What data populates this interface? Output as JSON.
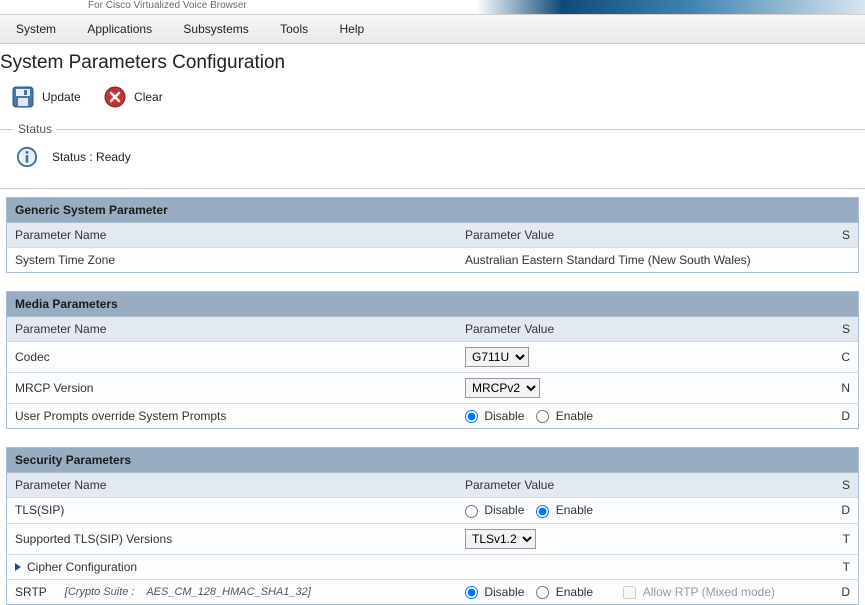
{
  "banner_subtitle": "For Cisco Virtualized Voice Browser",
  "menus": [
    "System",
    "Applications",
    "Subsystems",
    "Tools",
    "Help"
  ],
  "page_title": "System Parameters Configuration",
  "toolbar": {
    "update": "Update",
    "clear": "Clear"
  },
  "status": {
    "legend": "Status",
    "text": "Status : Ready"
  },
  "columns": {
    "name": "Parameter Name",
    "value": "Parameter Value",
    "suggested": "S"
  },
  "options": {
    "disable": "Disable",
    "enable": "Enable",
    "allow_rtp": "Allow RTP (Mixed mode)"
  },
  "sections": {
    "generic": {
      "title": "Generic System Parameter",
      "timezone_label": "System Time Zone",
      "timezone_value": "Australian Eastern Standard Time (New South Wales)"
    },
    "media": {
      "title": "Media Parameters",
      "codec_label": "Codec",
      "codec_options": [
        "G711U"
      ],
      "mrcp_label": "MRCP Version",
      "mrcp_options": [
        "MRCPv2"
      ],
      "user_prompts_label": "User Prompts override System Prompts",
      "user_prompts_value": "disable"
    },
    "security": {
      "title": "Security Parameters",
      "tls_label": "TLS(SIP)",
      "tls_value": "enable",
      "tls_versions_label": "Supported TLS(SIP) Versions",
      "tls_versions_options": [
        "TLSv1.2"
      ],
      "cipher_label": "Cipher Configuration",
      "srtp_label": "SRTP",
      "srtp_crypto_label": "[Crypto Suite :",
      "srtp_crypto_value": "AES_CM_128_HMAC_SHA1_32]",
      "srtp_value": "disable"
    }
  }
}
